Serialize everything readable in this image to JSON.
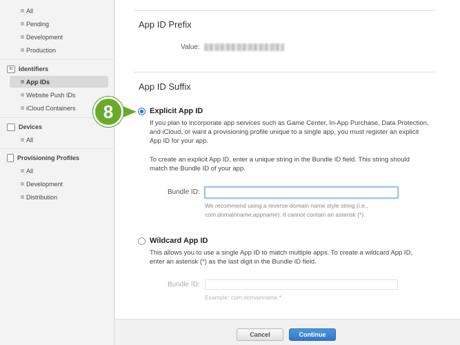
{
  "sidebar": {
    "top_items": [
      {
        "label": "All"
      },
      {
        "label": "Pending"
      },
      {
        "label": "Development"
      },
      {
        "label": "Production"
      }
    ],
    "identifiers": {
      "heading": "Identifiers",
      "icon_text": "ID",
      "items": [
        {
          "label": "App IDs",
          "active": true
        },
        {
          "label": "Website Push IDs"
        },
        {
          "label": "iCloud Containers"
        }
      ]
    },
    "devices": {
      "heading": "Devices",
      "items": [
        {
          "label": "All"
        }
      ]
    },
    "profiles": {
      "heading": "Provisioning Profiles",
      "items": [
        {
          "label": "All"
        },
        {
          "label": "Development"
        },
        {
          "label": "Distribution"
        }
      ]
    }
  },
  "prefix": {
    "title": "App ID Prefix",
    "value_label": "Value:"
  },
  "suffix": {
    "title": "App ID Suffix",
    "explicit": {
      "title": "Explicit App ID",
      "selected": true,
      "desc1": "If you plan to incorporate app services such as Game Center, In-App Purchase, Data Protection, and iCloud, or want a provisioning profile unique to a single app, you must register an explicit App ID for your app.",
      "desc2": "To create an explicit App ID, enter a unique string in the Bundle ID field. This string should match the Bundle ID of your app.",
      "bundle_label": "Bundle ID:",
      "bundle_value": "",
      "hint": "We recommend using a reverse-domain name style string (i.e., com.domainname.appname). It cannot contain an asterisk (*)."
    },
    "wildcard": {
      "title": "Wildcard App ID",
      "selected": false,
      "desc": "This allows you to use a single App ID to match multiple apps. To create a wildcard App ID, enter an asterisk (*) as the last digit in the Bundle ID field.",
      "bundle_label": "Bundle ID:",
      "bundle_value": "",
      "hint": "Example: com.domainname.*"
    }
  },
  "step_badge": "8",
  "footer": {
    "cancel": "Cancel",
    "continue": "Continue"
  },
  "colors": {
    "accent": "#2f78c8",
    "badge": "#6aaa2b"
  }
}
